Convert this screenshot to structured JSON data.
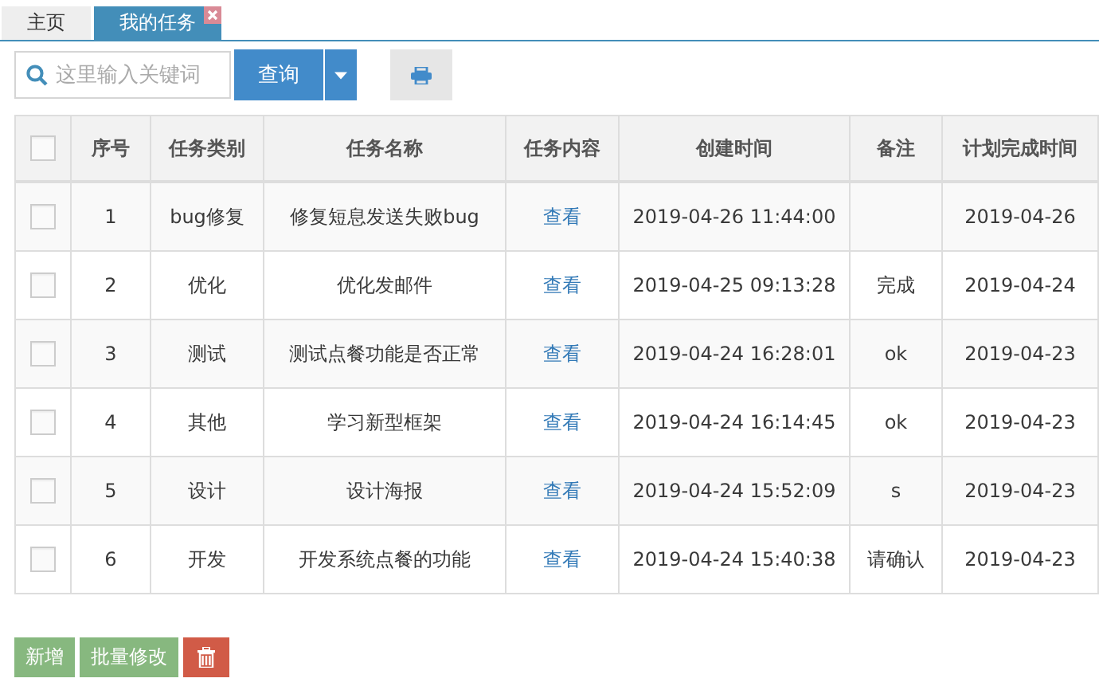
{
  "tabs": [
    {
      "label": "主页",
      "selected": false,
      "closable": false
    },
    {
      "label": "我的任务",
      "selected": true,
      "closable": true
    }
  ],
  "search": {
    "placeholder": "这里输入关键词"
  },
  "query_button": "查询",
  "table": {
    "select_all": {
      "checked": false
    },
    "columns": [
      "序号",
      "任务类别",
      "任务名称",
      "任务内容",
      "创建时间",
      "备注",
      "计划完成时间"
    ],
    "rows": [
      {
        "checked": false,
        "cells": [
          "1",
          "bug修复",
          "修复短息发送失败bug",
          "查看",
          "2019-04-26 11:44:00",
          "",
          "2019-04-26"
        ]
      },
      {
        "checked": false,
        "cells": [
          "2",
          "优化",
          "优化发邮件",
          "查看",
          "2019-04-25 09:13:28",
          "完成",
          "2019-04-24"
        ]
      },
      {
        "checked": false,
        "cells": [
          "3",
          "测试",
          "测试点餐功能是否正常",
          "查看",
          "2019-04-24 16:28:01",
          "ok",
          "2019-04-23"
        ]
      },
      {
        "checked": false,
        "cells": [
          "4",
          "其他",
          "学习新型框架",
          "查看",
          "2019-04-24 16:14:45",
          "ok",
          "2019-04-23"
        ]
      },
      {
        "checked": false,
        "cells": [
          "5",
          "设计",
          "设计海报",
          "查看",
          "2019-04-24 15:52:09",
          "s",
          "2019-04-23"
        ]
      },
      {
        "checked": false,
        "cells": [
          "6",
          "开发",
          "开发系统点餐的功能",
          "查看",
          "2019-04-24 15:40:38",
          "请确认",
          "2019-04-23"
        ]
      }
    ]
  },
  "actions": [
    "新增",
    "批量修改"
  ]
}
